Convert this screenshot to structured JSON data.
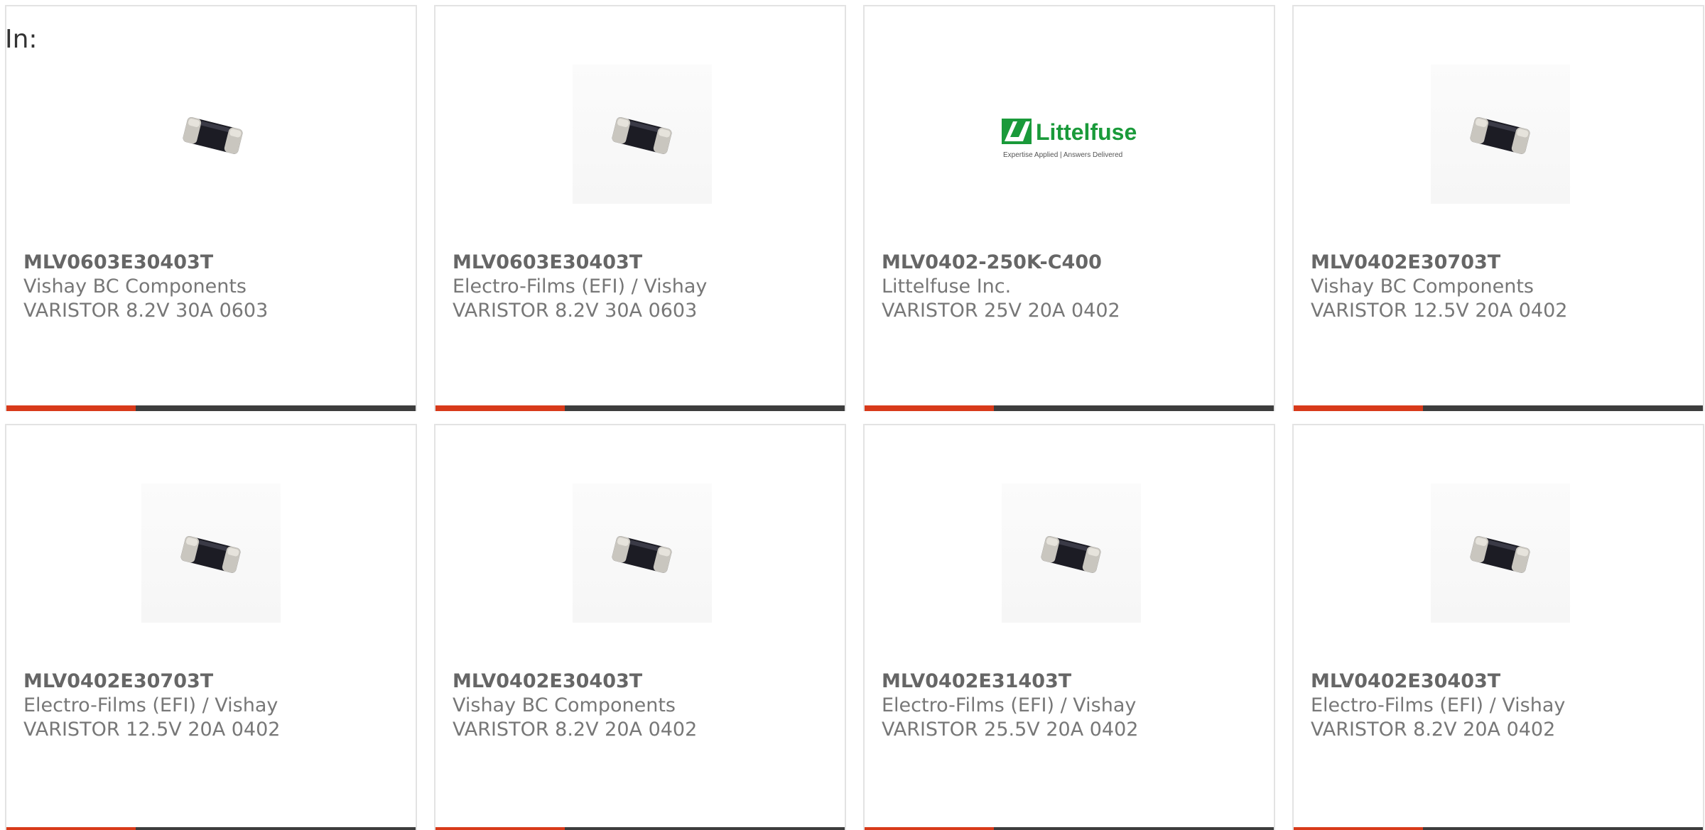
{
  "header": {
    "label": "In:"
  },
  "colors": {
    "accent": "#d83a1a",
    "bar": "#3d3d3d",
    "border": "#e3e3e3",
    "text": "#777777"
  },
  "cards": [
    {
      "part": "MLV0603E30403T",
      "manufacturer": "Vishay BC Components",
      "description": "VARISTOR 8.2V 30A 0603",
      "image": "varistor-chip-icon"
    },
    {
      "part": "MLV0603E30403T",
      "manufacturer": "Electro-Films (EFI) / Vishay",
      "description": "VARISTOR 8.2V 30A 0603",
      "image": "varistor-chip-icon"
    },
    {
      "part": "MLV0402-250K-C400",
      "manufacturer": "Littelfuse Inc.",
      "description": "VARISTOR 25V 20A 0402",
      "image": "littelfuse-logo",
      "logo_text": "Littelfuse",
      "logo_tagline": "Expertise Applied | Answers Delivered"
    },
    {
      "part": "MLV0402E30703T",
      "manufacturer": "Vishay BC Components",
      "description": "VARISTOR 12.5V 20A 0402",
      "image": "varistor-chip-icon"
    },
    {
      "part": "MLV0402E30703T",
      "manufacturer": "Electro-Films (EFI) / Vishay",
      "description": "VARISTOR 12.5V 20A 0402",
      "image": "varistor-chip-icon"
    },
    {
      "part": "MLV0402E30403T",
      "manufacturer": "Vishay BC Components",
      "description": "VARISTOR 8.2V 20A 0402",
      "image": "varistor-chip-icon"
    },
    {
      "part": "MLV0402E31403T",
      "manufacturer": "Electro-Films (EFI) / Vishay",
      "description": "VARISTOR 25.5V 20A 0402",
      "image": "varistor-chip-icon"
    },
    {
      "part": "MLV0402E30403T",
      "manufacturer": "Electro-Films (EFI) / Vishay",
      "description": "VARISTOR 8.2V 20A 0402",
      "image": "varistor-chip-icon"
    }
  ]
}
